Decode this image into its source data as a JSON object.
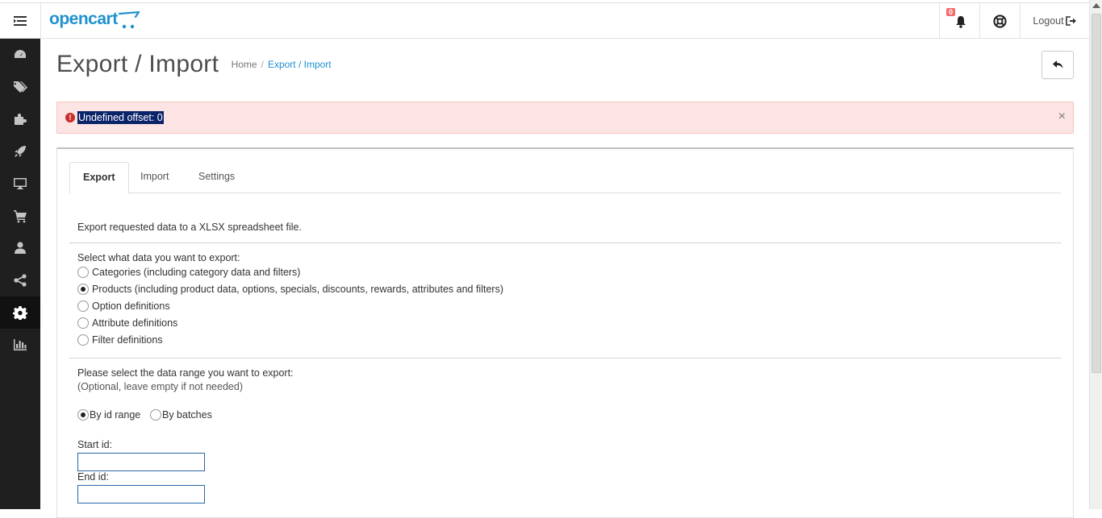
{
  "header": {
    "logo_text": "opencart",
    "notification_count": "0",
    "logout_label": "Logout"
  },
  "sidebar": {
    "items": [
      {
        "icon": "dashboard-icon"
      },
      {
        "icon": "tags-icon"
      },
      {
        "icon": "puzzle-icon"
      },
      {
        "icon": "rocket-icon"
      },
      {
        "icon": "desktop-icon"
      },
      {
        "icon": "shopping-cart-icon"
      },
      {
        "icon": "user-icon"
      },
      {
        "icon": "share-icon"
      },
      {
        "icon": "gear-icon",
        "active": true
      },
      {
        "icon": "bar-chart-icon"
      }
    ]
  },
  "page": {
    "title": "Export / Import",
    "breadcrumb": {
      "home": "Home",
      "separator": "/",
      "current": "Export / Import"
    }
  },
  "alert": {
    "text": "Undefined offset: 0",
    "close": "×"
  },
  "tabs": [
    {
      "label": "Export",
      "active": true
    },
    {
      "label": "Import"
    },
    {
      "label": "Settings"
    }
  ],
  "export": {
    "intro": "Export requested data to a XLSX spreadsheet file.",
    "select_label": "Select what data you want to export:",
    "options": [
      {
        "label": "Categories (including category data and filters)",
        "checked": false
      },
      {
        "label": "Products (including product data, options, specials, discounts, rewards, attributes and filters)",
        "checked": true
      },
      {
        "label": "Option definitions",
        "checked": false
      },
      {
        "label": "Attribute definitions",
        "checked": false
      },
      {
        "label": "Filter definitions",
        "checked": false
      }
    ],
    "range_label": "Please select the data range you want to export:",
    "range_hint": "(Optional, leave empty if not needed)",
    "range_modes": [
      {
        "label": "By id range",
        "checked": true
      },
      {
        "label": "By batches",
        "checked": false
      }
    ],
    "start_id_label": "Start id:",
    "start_id_value": "",
    "end_id_label": "End id:",
    "end_id_value": ""
  }
}
